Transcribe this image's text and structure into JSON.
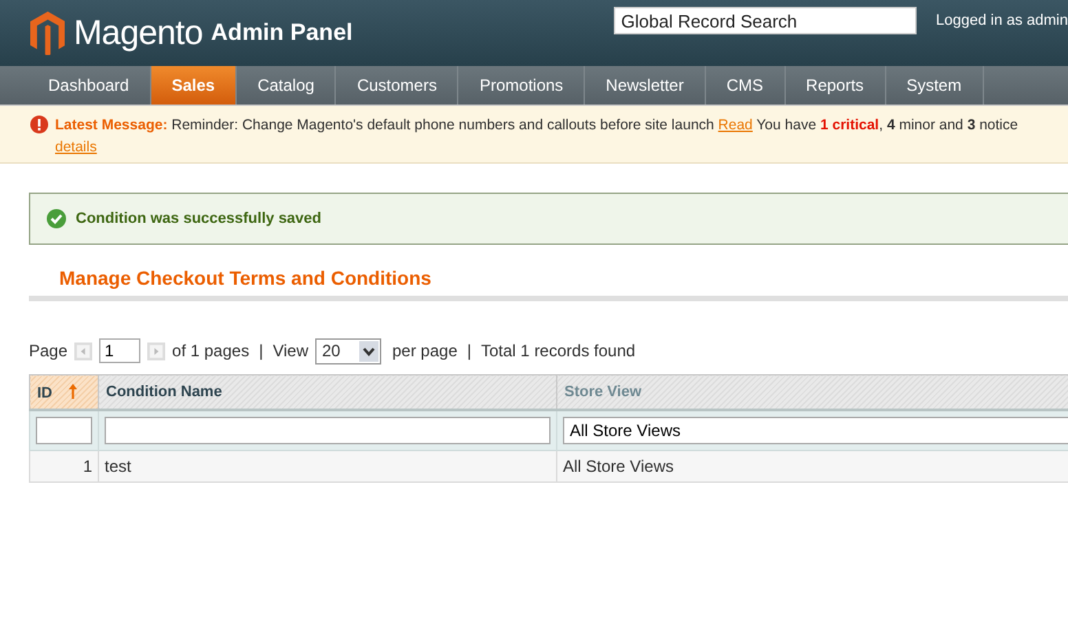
{
  "header": {
    "logo": "Magento",
    "subtitle": "Admin Panel",
    "search": {
      "value": "Global Record Search"
    },
    "user": "Logged in as admin"
  },
  "nav": [
    {
      "label": "Dashboard",
      "selected": false
    },
    {
      "label": "Sales",
      "selected": true
    },
    {
      "label": "Catalog",
      "selected": false
    },
    {
      "label": "Customers",
      "selected": false
    },
    {
      "label": "Promotions",
      "selected": false
    },
    {
      "label": "Newsletter",
      "selected": false
    },
    {
      "label": "CMS",
      "selected": false
    },
    {
      "label": "Reports",
      "selected": false
    },
    {
      "label": "System",
      "selected": false
    }
  ],
  "notice": {
    "label": "Latest Message:",
    "text": "Reminder: Change Magento's default phone numbers and callouts before site launch",
    "link": "Read",
    "parts": [
      {
        "text": "You have ",
        "kind": "plain"
      },
      {
        "text": "1 critical",
        "kind": "critical"
      },
      {
        "text": ", ",
        "kind": "plain"
      },
      {
        "text": "4",
        "kind": "bold"
      },
      {
        "text": " minor and ",
        "kind": "plain"
      },
      {
        "text": "3",
        "kind": "bold"
      },
      {
        "text": " notice",
        "kind": "plain"
      }
    ],
    "details": "details"
  },
  "success": "Condition was successfully saved",
  "title": "Manage Checkout Terms and Conditions",
  "pager": {
    "page_label": "Page",
    "separator": "|",
    "page": "1",
    "of_pages": "of 1 pages",
    "view_label": "View",
    "per_page": "20",
    "per_page_label": "per page",
    "total": "Total 1 records found"
  },
  "table": {
    "columns": [
      {
        "label": "ID",
        "sorted": true
      },
      {
        "label": "Condition Name",
        "sorted": false
      },
      {
        "label": "Store View",
        "sorted": false
      }
    ],
    "filters": {
      "store": "All Store Views"
    },
    "rows": [
      {
        "id": "1",
        "name": "test",
        "store": "All Store Views"
      }
    ]
  }
}
